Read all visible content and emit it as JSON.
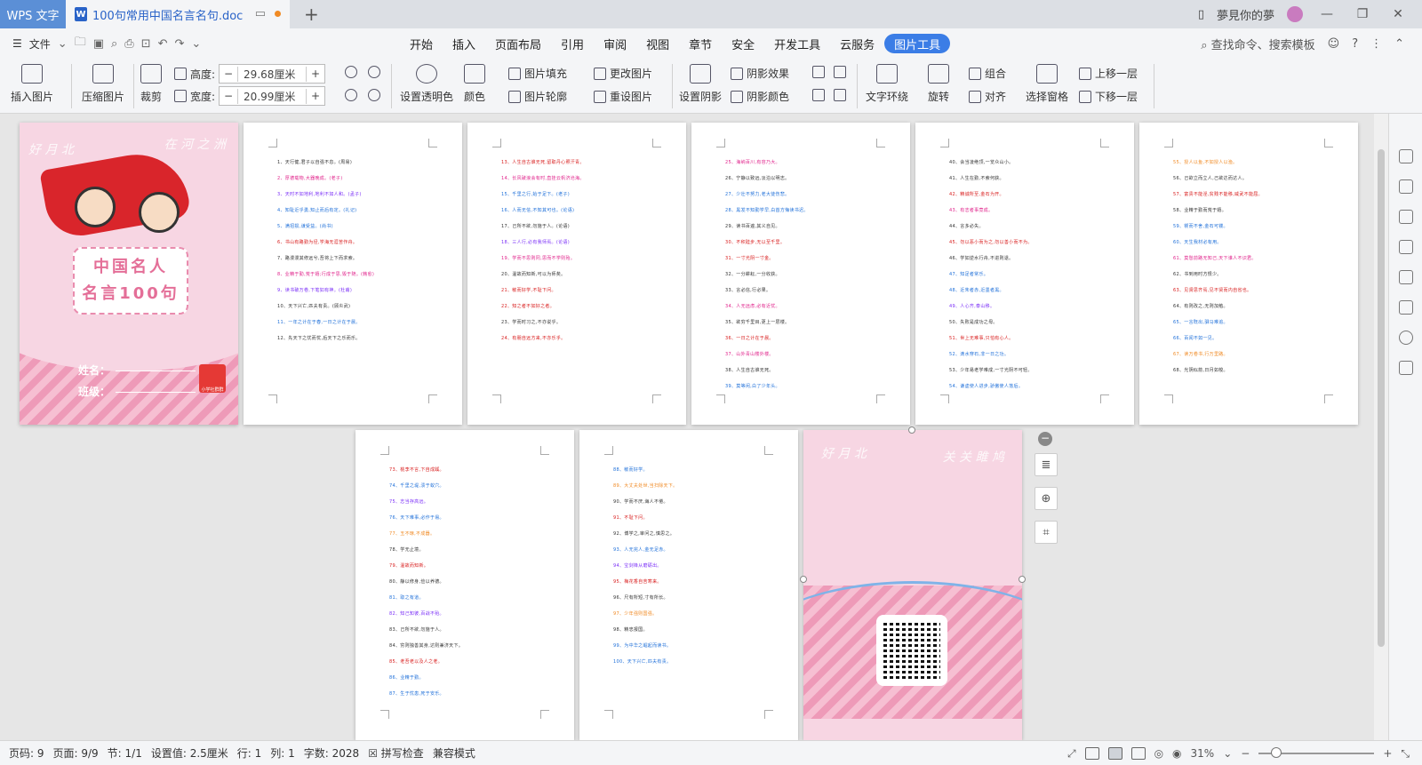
{
  "titlebar": {
    "app_tab": "WPS 文字",
    "doc_tab": "100句常用中国名言名句.doc",
    "doc_icon_letter": "W",
    "user_name": "夢見你的夢"
  },
  "menubar": {
    "file_label": "文件",
    "tabs": [
      "开始",
      "插入",
      "页面布局",
      "引用",
      "审阅",
      "视图",
      "章节",
      "安全",
      "开发工具",
      "云服务",
      "图片工具"
    ],
    "active_tab": "图片工具",
    "search_label": "查找命令、搜索模板"
  },
  "toolbar": {
    "insert_picture": "插入图片",
    "compress_picture": "压缩图片",
    "crop": "裁剪",
    "height_label": "高度:",
    "height_value": "29.68厘米",
    "width_label": "宽度:",
    "width_value": "20.99厘米",
    "set_transparent": "设置透明色",
    "color": "颜色",
    "picture_fill": "图片填充",
    "picture_outline": "图片轮廓",
    "change_picture": "更改图片",
    "reset_picture": "重设图片",
    "set_shadow": "设置阴影",
    "shadow_effect": "阴影效果",
    "shadow_color": "阴影颜色",
    "text_wrap": "文字环绕",
    "rotate": "旋转",
    "group": "组合",
    "align": "对齐",
    "selection_pane": "选择窗格",
    "bring_forward": "上移一层",
    "send_backward": "下移一层"
  },
  "cover": {
    "title_line1": "中国名人",
    "title_line2": "名言100句",
    "name_label": "姓名：",
    "class_label": "班级：",
    "logo_text": "小学社群群"
  },
  "pages": [
    {
      "lines": [
        {
          "t": "1、天行健,君子以自强不息。(周易)",
          "c": "#333"
        },
        {
          "t": "2、厚德载物,大器晚成。(老子)",
          "c": "#e0218a"
        },
        {
          "t": "3、天时不如地利,地利不如人和。(孟子)",
          "c": "#7b2ff7"
        },
        {
          "t": "4、知耻近乎勇,知止而后有定。(礼记)",
          "c": "#1e6fd9"
        },
        {
          "t": "5、满招损,谦受益。(尚书)",
          "c": "#1e6fd9"
        },
        {
          "t": "6、书山有路勤为径,学海无涯苦作舟。",
          "c": "#d81b1b"
        },
        {
          "t": "7、路漫漫其修远兮,吾将上下而求索。",
          "c": "#333"
        },
        {
          "t": "8、业精于勤,荒于嬉;行成于思,毁于随。(韩愈)",
          "c": "#e0218a"
        },
        {
          "t": "9、读书破万卷,下笔如有神。(杜甫)",
          "c": "#7b2ff7"
        },
        {
          "t": "10、天下兴亡,匹夫有责。(顾炎武)",
          "c": "#333"
        },
        {
          "t": "11、一年之计在于春,一日之计在于晨。",
          "c": "#1e6fd9"
        },
        {
          "t": "12、先天下之忧而忧,后天下之乐而乐。",
          "c": "#333"
        }
      ]
    },
    {
      "lines": [
        {
          "t": "13、人生自古谁无死,留取丹心照汗青。",
          "c": "#d81b1b"
        },
        {
          "t": "14、长风破浪会有时,直挂云帆济沧海。",
          "c": "#e0218a"
        },
        {
          "t": "15、千里之行,始于足下。(老子)",
          "c": "#1e6fd9"
        },
        {
          "t": "16、人而无信,不知其可也。(论语)",
          "c": "#1e6fd9"
        },
        {
          "t": "17、己所不欲,勿施于人。(论语)",
          "c": "#333"
        },
        {
          "t": "18、三人行,必有我师焉。(论语)",
          "c": "#7b2ff7"
        },
        {
          "t": "19、学而不思则罔,思而不学则殆。",
          "c": "#e0218a"
        },
        {
          "t": "20、温故而知新,可以为师矣。",
          "c": "#333"
        },
        {
          "t": "21、敏而好学,不耻下问。",
          "c": "#d81b1b"
        },
        {
          "t": "22、知之者不如好之者。",
          "c": "#d81b1b"
        },
        {
          "t": "23、学而时习之,不亦说乎。",
          "c": "#333"
        },
        {
          "t": "24、有朋自远方来,不亦乐乎。",
          "c": "#d81b1b"
        }
      ]
    },
    {
      "lines": [
        {
          "t": "25、海纳百川,有容乃大。",
          "c": "#e0218a"
        },
        {
          "t": "26、宁静以致远,淡泊以明志。",
          "c": "#333"
        },
        {
          "t": "27、少壮不努力,老大徒伤悲。",
          "c": "#1e6fd9"
        },
        {
          "t": "28、黑发不知勤学早,白首方悔读书迟。",
          "c": "#1e6fd9"
        },
        {
          "t": "29、读书百遍,其义自见。",
          "c": "#333"
        },
        {
          "t": "30、不积跬步,无以至千里。",
          "c": "#d81b1b"
        },
        {
          "t": "31、一寸光阴一寸金。",
          "c": "#d81b1b"
        },
        {
          "t": "32、一分耕耘,一分收获。",
          "c": "#333"
        },
        {
          "t": "33、言必信,行必果。",
          "c": "#333"
        },
        {
          "t": "34、人无远虑,必有近忧。",
          "c": "#e0218a"
        },
        {
          "t": "35、欲穷千里目,更上一层楼。",
          "c": "#333"
        },
        {
          "t": "36、一日之计在于晨。",
          "c": "#d81b1b"
        },
        {
          "t": "37、山外青山楼外楼。",
          "c": "#e0218a"
        },
        {
          "t": "38、人生自古谁无死。",
          "c": "#333"
        },
        {
          "t": "39、莫等闲,白了少年头。",
          "c": "#1e6fd9"
        }
      ]
    },
    {
      "lines": [
        {
          "t": "40、会当凌绝顶,一览众山小。",
          "c": "#333"
        },
        {
          "t": "41、人生在勤,不索何获。",
          "c": "#333"
        },
        {
          "t": "42、精诚所至,金石为开。",
          "c": "#d81b1b"
        },
        {
          "t": "43、有志者事竟成。",
          "c": "#e0218a"
        },
        {
          "t": "44、言多必失。",
          "c": "#333"
        },
        {
          "t": "45、勿以恶小而为之,勿以善小而不为。",
          "c": "#d81b1b"
        },
        {
          "t": "46、学如逆水行舟,不进则退。",
          "c": "#333"
        },
        {
          "t": "47、知足者常乐。",
          "c": "#1e6fd9"
        },
        {
          "t": "48、近朱者赤,近墨者黑。",
          "c": "#1e6fd9"
        },
        {
          "t": "49、人心齐,泰山移。",
          "c": "#7b2ff7"
        },
        {
          "t": "50、失败是成功之母。",
          "c": "#333"
        },
        {
          "t": "51、世上无难事,只怕有心人。",
          "c": "#d81b1b"
        },
        {
          "t": "52、滴水穿石,非一日之功。",
          "c": "#1e6fd9"
        },
        {
          "t": "53、少年易老学难成,一寸光阴不可轻。",
          "c": "#333"
        },
        {
          "t": "54、谦虚使人进步,骄傲使人落后。",
          "c": "#1e6fd9"
        }
      ]
    },
    {
      "lines": [
        {
          "t": "55、授人以鱼,不如授人以渔。",
          "c": "#f08a24"
        },
        {
          "t": "56、己欲立而立人,己欲达而达人。",
          "c": "#333"
        },
        {
          "t": "57、富贵不能淫,贫贱不能移,威武不能屈。",
          "c": "#d81b1b"
        },
        {
          "t": "58、业精于勤而荒于嬉。",
          "c": "#333"
        },
        {
          "t": "59、锲而不舍,金石可镂。",
          "c": "#1e6fd9"
        },
        {
          "t": "60、天生我材必有用。",
          "c": "#1e6fd9"
        },
        {
          "t": "61、莫愁前路无知己,天下谁人不识君。",
          "c": "#e0218a"
        },
        {
          "t": "62、书到用时方恨少。",
          "c": "#333"
        },
        {
          "t": "63、见贤思齐焉,见不贤而内自省也。",
          "c": "#d81b1b"
        },
        {
          "t": "64、有则改之,无则加勉。",
          "c": "#333"
        },
        {
          "t": "65、一言既出,驷马难追。",
          "c": "#1e6fd9"
        },
        {
          "t": "66、百闻不如一见。",
          "c": "#1e6fd9"
        },
        {
          "t": "67、读万卷书,行万里路。",
          "c": "#f08a24"
        },
        {
          "t": "68、光阴似箭,日月如梭。",
          "c": "#333"
        }
      ]
    },
    {
      "lines": [
        {
          "t": "73、桃李不言,下自成蹊。",
          "c": "#d81b1b"
        },
        {
          "t": "74、千里之堤,溃于蚁穴。",
          "c": "#1e6fd9"
        },
        {
          "t": "75、志当存高远。",
          "c": "#7b2ff7"
        },
        {
          "t": "76、天下难事,必作于易。",
          "c": "#1e6fd9"
        },
        {
          "t": "77、玉不琢,不成器。",
          "c": "#f08a24"
        },
        {
          "t": "78、学无止境。",
          "c": "#333"
        },
        {
          "t": "79、温故而知新。",
          "c": "#d81b1b"
        },
        {
          "t": "80、静以修身,俭以养德。",
          "c": "#333"
        },
        {
          "t": "81、取之有道。",
          "c": "#1e6fd9"
        },
        {
          "t": "82、知己知彼,百战不殆。",
          "c": "#7b2ff7"
        },
        {
          "t": "83、己所不欲,勿施于人。",
          "c": "#333"
        },
        {
          "t": "84、穷则独善其身,达则兼济天下。",
          "c": "#333"
        },
        {
          "t": "85、老吾老以及人之老。",
          "c": "#d81b1b"
        },
        {
          "t": "86、业精于勤。",
          "c": "#1e6fd9"
        },
        {
          "t": "87、生于忧患,死于安乐。",
          "c": "#1e6fd9"
        }
      ]
    },
    {
      "lines": [
        {
          "t": "88、敏而好学。",
          "c": "#1e6fd9"
        },
        {
          "t": "89、大丈夫处世,当扫除天下。",
          "c": "#f08a24"
        },
        {
          "t": "90、学而不厌,诲人不倦。",
          "c": "#333"
        },
        {
          "t": "91、不耻下问。",
          "c": "#d81b1b"
        },
        {
          "t": "92、博学之,审问之,慎思之。",
          "c": "#333"
        },
        {
          "t": "93、人无完人,金无足赤。",
          "c": "#1e6fd9"
        },
        {
          "t": "94、宝剑锋从磨砺出。",
          "c": "#7b2ff7"
        },
        {
          "t": "95、梅花香自苦寒来。",
          "c": "#d81b1b"
        },
        {
          "t": "96、尺有所短,寸有所长。",
          "c": "#333"
        },
        {
          "t": "97、少年强则国强。",
          "c": "#f08a24"
        },
        {
          "t": "98、精忠报国。",
          "c": "#333"
        },
        {
          "t": "99、为中华之崛起而读书。",
          "c": "#1e6fd9"
        },
        {
          "t": "100、天下兴亡,匹夫有责。",
          "c": "#1e6fd9"
        }
      ]
    }
  ],
  "statusbar": {
    "page_code": "页码: 9",
    "page_of": "页面: 9/9",
    "section": "节: 1/1",
    "setting": "设置值: 2.5厘米",
    "row": "行: 1",
    "col": "列: 1",
    "word_count": "字数: 2028",
    "spell_check": "拼写检查",
    "compat_mode": "兼容模式",
    "zoom": "31%"
  }
}
